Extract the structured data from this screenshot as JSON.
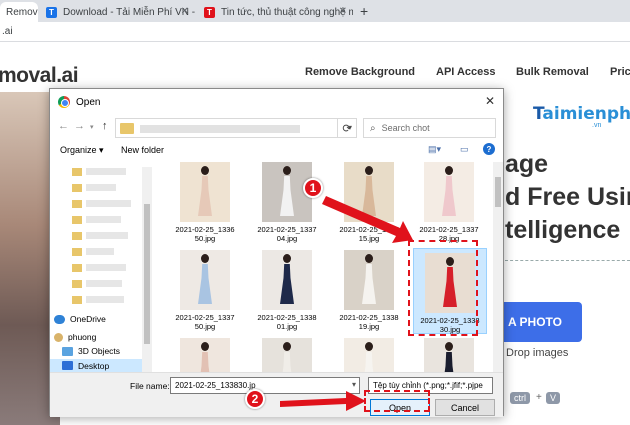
{
  "browser": {
    "tabs": [
      {
        "title": "Remove b",
        "favicon": "remove-bg-favicon"
      },
      {
        "title": "Download - Tải Miễn Phí VN - Ph",
        "favicon": "taimienphi-favicon"
      },
      {
        "title": "Tin tức, thủ thuật công nghệ mớ",
        "favicon": "taimienphi-favicon"
      }
    ],
    "new_tab": "+",
    "address": ".ai"
  },
  "site": {
    "logo": "moval.ai",
    "nav": [
      "Remove Background",
      "API Access",
      "Bulk Removal",
      "Pric"
    ],
    "hero_lines": [
      "age",
      "d Free Usin",
      "telligence"
    ],
    "upload_button": "A PHOTO",
    "drop_text": "Drop images",
    "keys": [
      "ctrl",
      "+",
      "V"
    ],
    "watermark": "aimienphi",
    "watermark_t": "T",
    "watermark_sub": ".vn"
  },
  "dialog": {
    "title": "Open",
    "search_placeholder": "Search chot",
    "organize": "Organize ▾",
    "new_folder": "New folder",
    "nav_pane": {
      "onedrive": "OneDrive",
      "user": "phuong",
      "objects": "3D Objects",
      "desktop": "Desktop"
    },
    "files": [
      [
        "2021-02-25_1336",
        "50.jpg"
      ],
      [
        "2021-02-25_1337",
        "04.jpg"
      ],
      [
        "2021-02-25_1337",
        "15.jpg"
      ],
      [
        "2021-02-25_1337",
        "28.jpg"
      ],
      [
        "2021-02-25_1337",
        "50.jpg"
      ],
      [
        "2021-02-25_1338",
        "01.jpg"
      ],
      [
        "2021-02-25_1338",
        "19.jpg"
      ],
      [
        "2021-02-25_1338",
        "30.jpg"
      ]
    ],
    "file_name_label": "File name:",
    "file_name_value": "2021-02-25_133830.jp",
    "file_type": "Tệp tùy chỉnh (*.png;*.jfif;*.pjpe",
    "open_button": "Open",
    "cancel_button": "Cancel"
  },
  "annotations": {
    "step1": "1",
    "step2": "2",
    "color": "#e0121b"
  }
}
